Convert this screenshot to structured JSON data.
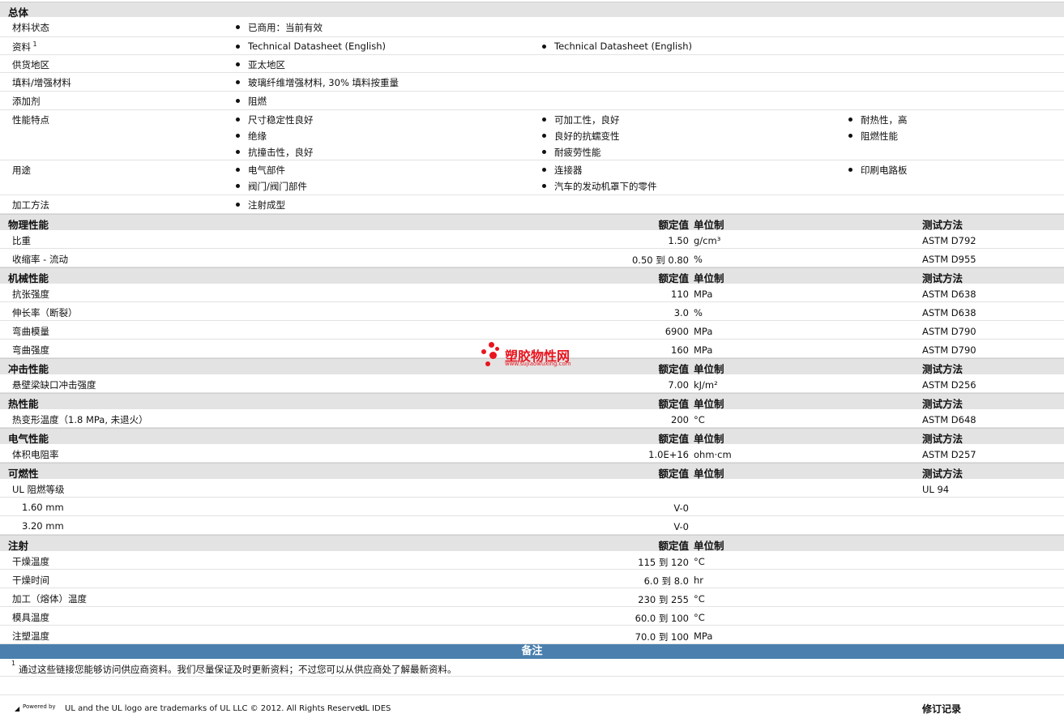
{
  "general": {
    "title": "总体",
    "rows": [
      {
        "label": "材料状态",
        "cols": [
          [
            "已商用：当前有效"
          ]
        ]
      },
      {
        "label": "资料",
        "sup": "1",
        "links": true,
        "cols": [
          [
            "Technical Datasheet (English)"
          ],
          [
            "Technical Datasheet (English)"
          ]
        ]
      },
      {
        "label": "供货地区",
        "cols": [
          [
            "亚太地区"
          ]
        ]
      },
      {
        "label": "填料/增强材料",
        "cols": [
          [
            "玻璃纤维增强材料, 30% 填料按重量"
          ]
        ]
      },
      {
        "label": "添加剂",
        "cols": [
          [
            "阻燃"
          ]
        ]
      },
      {
        "label": "性能特点",
        "cols": [
          [
            "尺寸稳定性良好",
            "绝缘",
            "抗撞击性，良好"
          ],
          [
            "可加工性，良好",
            "良好的抗蠕变性",
            "耐疲劳性能"
          ],
          [
            "耐热性，高",
            "阻燃性能"
          ]
        ]
      },
      {
        "label": "用途",
        "cols": [
          [
            "电气部件",
            "阀门/阀门部件"
          ],
          [
            "连接器",
            "汽车的发动机罩下的零件"
          ],
          [
            "印刷电路板"
          ]
        ]
      },
      {
        "label": "加工方法",
        "cols": [
          [
            "注射成型"
          ]
        ]
      }
    ]
  },
  "col_headers": {
    "nominal": "额定值",
    "unit": "单位制",
    "method": "测试方法"
  },
  "sections": [
    {
      "title": "物理性能",
      "method_header": true,
      "rows": [
        {
          "label": "比重",
          "value": "1.50",
          "unit": "g/cm³",
          "method": "ASTM D792"
        },
        {
          "label": "收缩率 - 流动",
          "value": "0.50 到  0.80",
          "unit": "%",
          "method": "ASTM D955"
        }
      ]
    },
    {
      "title": "机械性能",
      "method_header": true,
      "rows": [
        {
          "label": "抗张强度",
          "value": "110",
          "unit": "MPa",
          "method": "ASTM D638"
        },
        {
          "label": "伸长率（断裂）",
          "value": "3.0",
          "unit": "%",
          "method": "ASTM D638"
        },
        {
          "label": "弯曲模量",
          "value": "6900",
          "unit": "MPa",
          "method": "ASTM D790"
        },
        {
          "label": "弯曲强度",
          "value": "160",
          "unit": "MPa",
          "method": "ASTM D790"
        }
      ]
    },
    {
      "title": "冲击性能",
      "method_header": true,
      "rows": [
        {
          "label": "悬壁梁缺口冲击强度",
          "value": "7.00",
          "unit": "kJ/m²",
          "method": "ASTM D256"
        }
      ]
    },
    {
      "title": "热性能",
      "method_header": true,
      "rows": [
        {
          "label": "热变形温度（1.8 MPa, 未退火）",
          "value": "200",
          "unit": "°C",
          "method": "ASTM D648"
        }
      ]
    },
    {
      "title": "电气性能",
      "method_header": true,
      "rows": [
        {
          "label": "体积电阻率",
          "value": "1.0E+16",
          "unit": "ohm·cm",
          "method": "ASTM D257"
        }
      ]
    },
    {
      "title": "可燃性",
      "method_header": true,
      "rows": [
        {
          "label": "UL 阻燃等级",
          "value": "",
          "unit": "",
          "method": "UL 94"
        },
        {
          "label": "1.60 mm",
          "indent": true,
          "value": "V-0",
          "unit": "",
          "method": ""
        },
        {
          "label": "3.20 mm",
          "indent": true,
          "value": "V-0",
          "unit": "",
          "method": ""
        }
      ]
    },
    {
      "title": "注射",
      "method_header": false,
      "rows": [
        {
          "label": "干燥温度",
          "value": "115 到  120",
          "unit": "°C",
          "method": ""
        },
        {
          "label": "干燥时间",
          "value": "6.0 到  8.0",
          "unit": "hr",
          "method": ""
        },
        {
          "label": "加工（熔体）温度",
          "value": "230 到  255",
          "unit": "°C",
          "method": ""
        },
        {
          "label": "模具温度",
          "value": "60.0 到  100",
          "unit": "°C",
          "method": ""
        },
        {
          "label": "注塑温度",
          "value": "70.0 到  100",
          "unit": "MPa",
          "method": ""
        }
      ]
    }
  ],
  "notes": {
    "title": "备注",
    "sup": "1",
    "text": "通过这些链接您能够访问供应商资料。我们尽量保证及时更新资料；不过您可以从供应商处了解最新资料。"
  },
  "watermark": {
    "name": "塑胶物性网",
    "url": "www.sujiaowuxing.com",
    "colors": {
      "red": "#e8141e"
    }
  },
  "footer": {
    "powered": "Powered by",
    "text": "UL and the UL logo are trademarks of UL LLC © 2012. All Rights Reserved.",
    "link": "UL IDES",
    "revision": "修订记录"
  }
}
